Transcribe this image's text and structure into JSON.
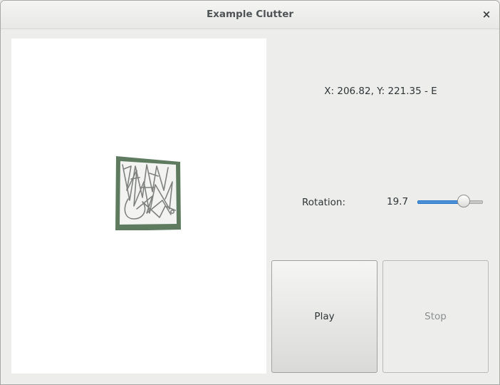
{
  "window": {
    "title": "Example Clutter",
    "close_glyph": "×"
  },
  "stage": {
    "background": "#ffffff",
    "actor": {
      "frame_color": "#5e7b60",
      "icon": "scribble-texture"
    }
  },
  "status": {
    "coords_text": "X: 206.82, Y: 221.35 - E"
  },
  "rotation": {
    "label": "Rotation:",
    "value_text": "19.7",
    "level": 0.75
  },
  "buttons": {
    "play_label": "Play",
    "stop_label": "Stop"
  },
  "colors": {
    "accent": "#4a90d9",
    "text": "#2e3436",
    "disabled_text": "#8b8e8f"
  }
}
